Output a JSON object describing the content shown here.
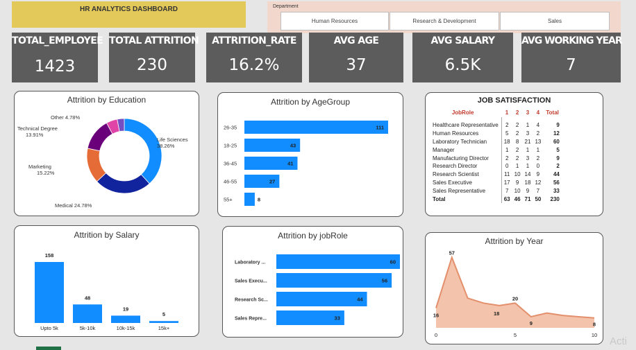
{
  "header": {
    "title": "HR ANALYTICS DASHBOARD"
  },
  "department_filter": {
    "label": "Department",
    "options": [
      "Human Resources",
      "Research & Development",
      "Sales"
    ]
  },
  "kpis": [
    {
      "label": "TOTAL_EMPLOYEE",
      "value": "1423"
    },
    {
      "label": "TOTAL ATTRITION",
      "value": "230"
    },
    {
      "label": "ATTRITION_RATE",
      "value": "16.2%"
    },
    {
      "label": "AVG AGE",
      "value": "37"
    },
    {
      "label": "AVG SALARY",
      "value": "6.5K"
    },
    {
      "label": "AVG WORKING YEAR",
      "value": "7"
    }
  ],
  "job_satisfaction": {
    "title": "JOB SATISFACTION",
    "headers": [
      "JobRole",
      "1",
      "2",
      "3",
      "4",
      "Total"
    ],
    "rows": [
      [
        "Healthcare Representative",
        "2",
        "2",
        "1",
        "4",
        "9"
      ],
      [
        "Human Resources",
        "5",
        "2",
        "3",
        "2",
        "12"
      ],
      [
        "Laboratory Technician",
        "18",
        "8",
        "21",
        "13",
        "60"
      ],
      [
        "Manager",
        "1",
        "2",
        "1",
        "1",
        "5"
      ],
      [
        "Manufacturing Director",
        "2",
        "2",
        "3",
        "2",
        "9"
      ],
      [
        "Research Director",
        "0",
        "1",
        "1",
        "0",
        "2"
      ],
      [
        "Research Scientist",
        "11",
        "10",
        "14",
        "9",
        "44"
      ],
      [
        "Sales Executive",
        "17",
        "9",
        "18",
        "12",
        "56"
      ],
      [
        "Sales Representative",
        "7",
        "10",
        "9",
        "7",
        "33"
      ],
      [
        "Total",
        "63",
        "46",
        "71",
        "50",
        "230"
      ]
    ]
  },
  "colors": {
    "bar": "#118dff",
    "area_fill": "#f3c3ab",
    "area_line": "#e38f6b",
    "kpi_bg": "#5c5c5c",
    "title_bg": "#e3c95a"
  },
  "chart_data": [
    {
      "type": "pie",
      "title": "Attrition by Education",
      "categories": [
        "Life Sciences",
        "Medical",
        "Marketing",
        "Technical Degree",
        "Other",
        "Human Resources"
      ],
      "values": [
        38.26,
        24.78,
        15.22,
        13.91,
        4.78,
        3.05
      ],
      "labels": [
        "Life Sciences\n38.26%",
        "Medical 24.78%",
        "Marketing\n15.22%",
        "Technical Degree\n13.91%",
        "Other 4.78%",
        ""
      ],
      "colors": [
        "#118dff",
        "#12239e",
        "#e66c37",
        "#6b007b",
        "#e044a7",
        "#744ec2"
      ]
    },
    {
      "type": "bar",
      "orientation": "horizontal",
      "title": "Attrition by AgeGroup",
      "categories": [
        "26-35",
        "18-25",
        "36-45",
        "46-55",
        "55+"
      ],
      "values": [
        111,
        43,
        41,
        27,
        8
      ]
    },
    {
      "type": "bar",
      "title": "Attrition by Salary",
      "categories": [
        "Upto 5k",
        "5k-10k",
        "10k-15k",
        "15k+"
      ],
      "values": [
        158,
        48,
        19,
        5
      ]
    },
    {
      "type": "bar",
      "orientation": "horizontal",
      "title": "Attrition by jobRole",
      "categories": [
        "Laboratory ...",
        "Sales Execu...",
        "Research Sc...",
        "Sales Repre..."
      ],
      "values": [
        60,
        56,
        44,
        33
      ]
    },
    {
      "type": "area",
      "title": "Attrition by Year",
      "x": [
        0,
        1,
        2,
        3,
        4,
        5,
        6,
        7,
        8,
        9,
        10
      ],
      "values": [
        16,
        57,
        24,
        20,
        18,
        20,
        9,
        12,
        10,
        9,
        8
      ],
      "point_labels": {
        "0": "16",
        "1": "57",
        "4": "18",
        "5": "20",
        "6": "9",
        "10": "8"
      },
      "xticks": [
        "0",
        "5",
        "10"
      ],
      "xlim": [
        0,
        10
      ]
    }
  ],
  "watermark": "Acti"
}
